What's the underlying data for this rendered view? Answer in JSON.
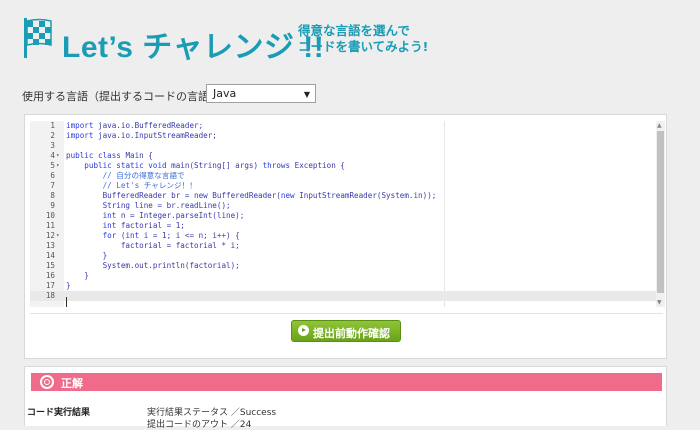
{
  "header": {
    "title": "Let’s チャレンジ !!",
    "subtitle_line1": "得意な言語を選んで",
    "subtitle_line2": "コードを書いてみよう!",
    "accent_color": "#1b9cb5"
  },
  "language": {
    "label": "使用する言語（提出するコードの言語）",
    "selected": "Java"
  },
  "editor": {
    "lines": [
      {
        "n": "1",
        "fold": "",
        "html": "<span class=\"kw\">import</span> java.io.BufferedReader;"
      },
      {
        "n": "2",
        "fold": "",
        "html": "<span class=\"kw\">import</span> java.io.InputStreamReader;"
      },
      {
        "n": "3",
        "fold": "",
        "html": ""
      },
      {
        "n": "4",
        "fold": "▾",
        "html": "<span class=\"kw\">public class</span> Main {"
      },
      {
        "n": "5",
        "fold": "▾",
        "html": "    <span class=\"kw\">public static void</span> main(String[] args) <span class=\"kw\">throws</span> Exception {"
      },
      {
        "n": "6",
        "fold": "",
        "html": "        <span class=\"cm\">// 自分の得意な言語で</span>"
      },
      {
        "n": "7",
        "fold": "",
        "html": "        <span class=\"cm\">// Let's チャレンジ！！</span>"
      },
      {
        "n": "8",
        "fold": "",
        "html": "        BufferedReader br = <span class=\"kw\">new</span> BufferedReader(<span class=\"kw\">new</span> InputStreamReader(System.in));"
      },
      {
        "n": "9",
        "fold": "",
        "html": "        String line = br.readLine();"
      },
      {
        "n": "10",
        "fold": "",
        "html": "        <span class=\"kw\">int</span> n = Integer.parseInt(line);"
      },
      {
        "n": "11",
        "fold": "",
        "html": "        <span class=\"kw\">int</span> factorial = 1;"
      },
      {
        "n": "12",
        "fold": "▾",
        "html": "        <span class=\"kw\">for</span> (<span class=\"kw\">int</span> i = 1; i <= n; i++) {"
      },
      {
        "n": "13",
        "fold": "",
        "html": "            factorial = factorial * i;"
      },
      {
        "n": "14",
        "fold": "",
        "html": "        }"
      },
      {
        "n": "15",
        "fold": "",
        "html": "        System.out.println(factorial);"
      },
      {
        "n": "16",
        "fold": "",
        "html": "    }"
      },
      {
        "n": "17",
        "fold": "",
        "html": "}"
      },
      {
        "n": "18",
        "fold": "",
        "html": ""
      }
    ]
  },
  "run_button": {
    "label": "提出前動作確認"
  },
  "result": {
    "title": "正解",
    "bar_color": "#f06a8a",
    "section_label": "コード実行結果",
    "line1": "実行結果ステータス ／Success",
    "line2": "提出コードのアウト ／24"
  }
}
